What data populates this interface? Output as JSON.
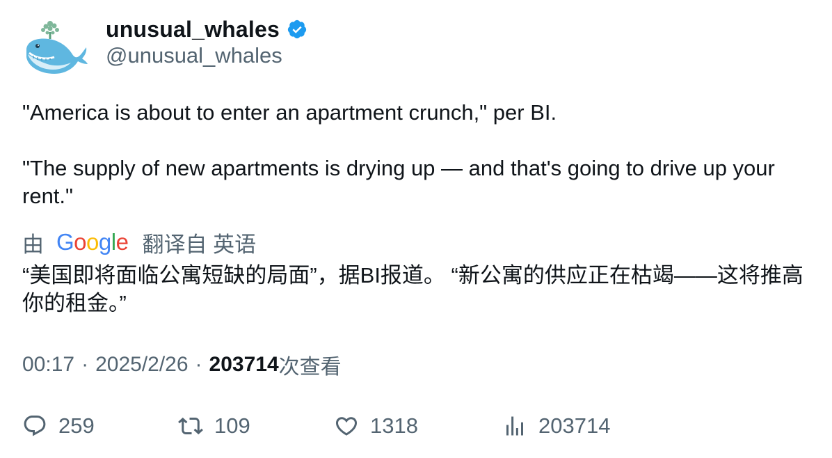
{
  "author": {
    "display_name": "unusual_whales",
    "handle": "@unusual_whales",
    "verified": true,
    "avatar_icon": "whale-avatar-icon",
    "verified_color": "#1d9bf0"
  },
  "tweet": {
    "paragraphs": [
      "\"America is about to enter an apartment crunch,\" per BI.",
      "\"The supply of new apartments is drying up — and that's going to drive up your rent.\""
    ]
  },
  "translation": {
    "prefix": "由",
    "provider": "Google",
    "suffix": "翻译自 英语",
    "text": "“美国即将面临公寓短缺的局面”，据BI报道。 “新公寓的供应正在枯竭——这将推高你的租金。”"
  },
  "meta": {
    "time": "00:17",
    "separator": "·",
    "date": "2025/2/26",
    "views_count": "203714",
    "views_label": "次查看"
  },
  "actions": {
    "reply_count": "259",
    "retweet_count": "109",
    "like_count": "1318",
    "views_count": "203714"
  },
  "colors": {
    "text_primary": "#0f1419",
    "text_secondary": "#536471",
    "verified_blue": "#1d9bf0"
  }
}
